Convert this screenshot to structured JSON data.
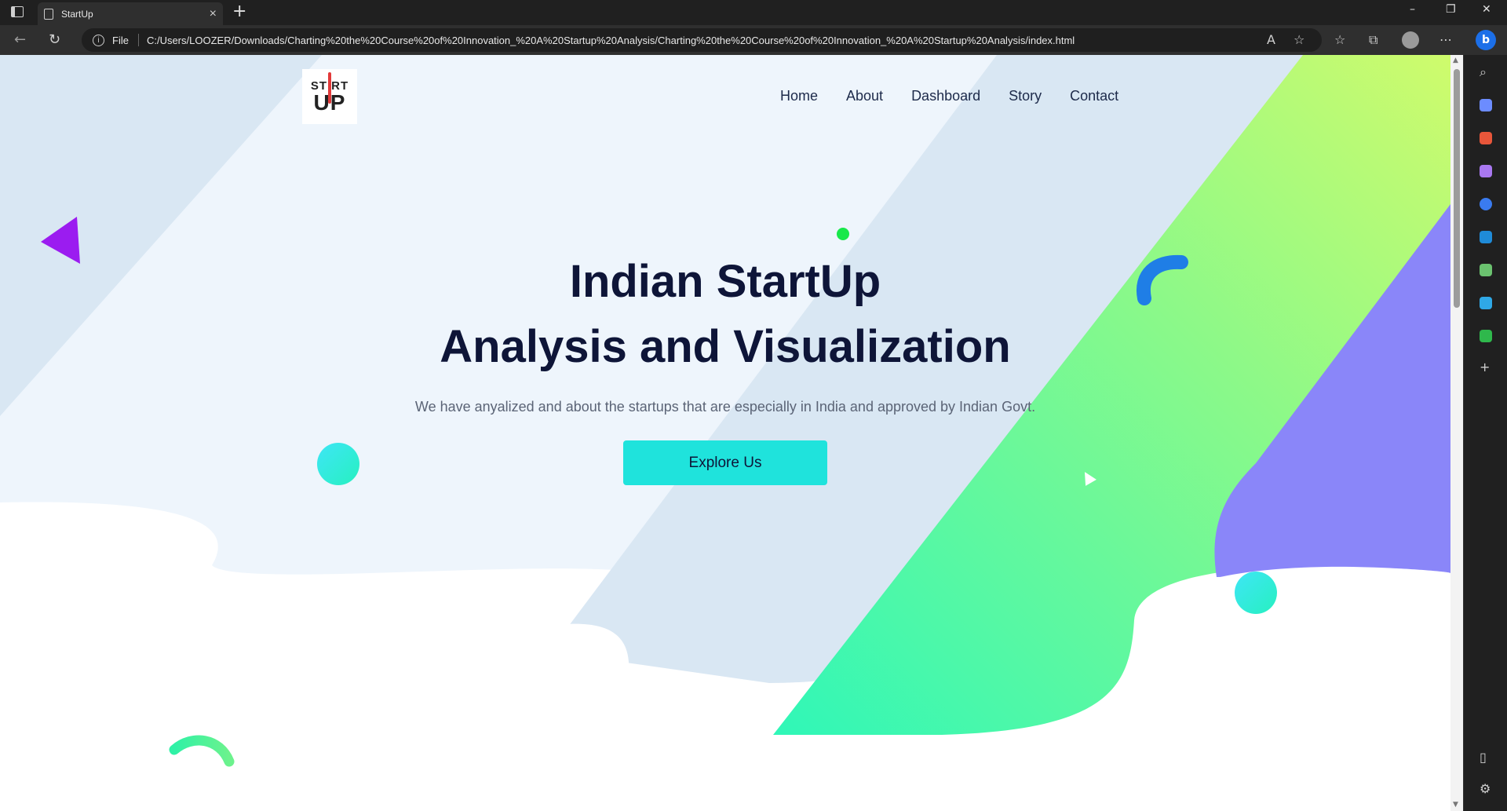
{
  "browser": {
    "tab_title": "StartUp",
    "file_label": "File",
    "url": "C:/Users/LOOZER/Downloads/Charting%20the%20Course%20of%20Innovation_%20A%20Startup%20Analysis/Charting%20the%20Course%20of%20Innovation_%20A%20Startup%20Analysis/index.html"
  },
  "logo": {
    "line1": "ST RT",
    "line2": "UP"
  },
  "nav": {
    "items": [
      "Home",
      "About",
      "Dashboard",
      "Story",
      "Contact"
    ]
  },
  "hero": {
    "title_line1": "Indian StartUp",
    "title_line2": "Analysis and Visualization",
    "subtitle": "We have anyalized and about the startups that are especially in India and approved by Indian Govt.",
    "cta_label": "Explore Us"
  },
  "colors": {
    "accent": "#1fe3dc",
    "heading": "#0e1538",
    "green_start": "#2ff7b8",
    "green_end": "#c6fb6e",
    "purple": "#8a86f9",
    "triangle": "#9b1cf0"
  }
}
